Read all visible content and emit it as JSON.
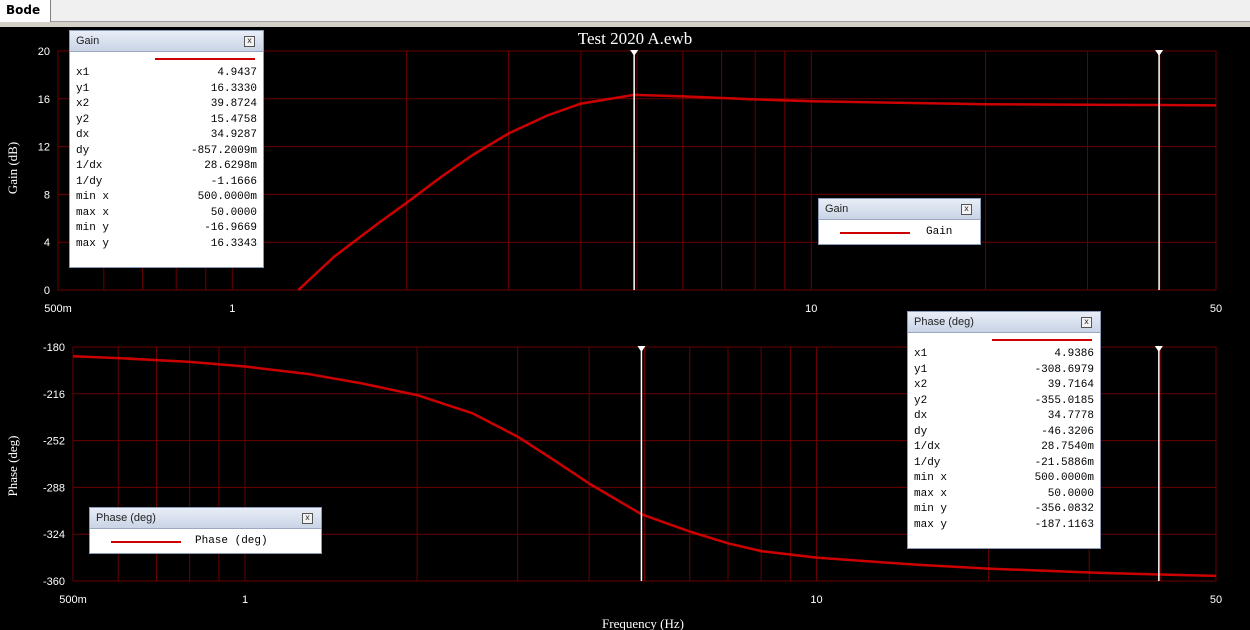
{
  "tab": {
    "label": "Bode"
  },
  "title": "Test 2020 A.ewb",
  "gain_plot": {
    "ylabel": "Gain (dB)",
    "y_ticks": [
      "20",
      "16",
      "12",
      "8",
      "4",
      "0"
    ],
    "x_ticks": [
      "500m",
      "1",
      "10",
      "50"
    ],
    "cursor1_x": 4.9437,
    "cursor2_x": 39.8724,
    "legend": {
      "title": "Gain",
      "label": "Gain"
    },
    "info": {
      "title": "Gain",
      "rows": [
        {
          "k": "x1",
          "v": "4.9437"
        },
        {
          "k": "y1",
          "v": "16.3330"
        },
        {
          "k": "x2",
          "v": "39.8724"
        },
        {
          "k": "y2",
          "v": "15.4758"
        },
        {
          "k": "dx",
          "v": "34.9287"
        },
        {
          "k": "dy",
          "v": "-857.2009m"
        },
        {
          "k": "1/dx",
          "v": "28.6298m"
        },
        {
          "k": "1/dy",
          "v": "-1.1666"
        },
        {
          "k": "min x",
          "v": "500.0000m"
        },
        {
          "k": "max x",
          "v": "50.0000"
        },
        {
          "k": "min y",
          "v": "-16.9669"
        },
        {
          "k": "max y",
          "v": "16.3343"
        }
      ]
    }
  },
  "phase_plot": {
    "ylabel": "Phase (deg)",
    "xlabel": "Frequency (Hz)",
    "y_ticks": [
      "-180",
      "-216",
      "-252",
      "-288",
      "-324",
      "-360"
    ],
    "x_ticks": [
      "500m",
      "1",
      "10",
      "50"
    ],
    "cursor1_x": 4.9386,
    "cursor2_x": 39.7164,
    "legend": {
      "title": "Phase (deg)",
      "label": "Phase (deg)"
    },
    "info": {
      "title": "Phase (deg)",
      "rows": [
        {
          "k": "x1",
          "v": "4.9386"
        },
        {
          "k": "y1",
          "v": "-308.6979"
        },
        {
          "k": "x2",
          "v": "39.7164"
        },
        {
          "k": "y2",
          "v": "-355.0185"
        },
        {
          "k": "dx",
          "v": "34.7778"
        },
        {
          "k": "dy",
          "v": "-46.3206"
        },
        {
          "k": "1/dx",
          "v": "28.7540m"
        },
        {
          "k": "1/dy",
          "v": "-21.5886m"
        },
        {
          "k": "min x",
          "v": "500.0000m"
        },
        {
          "k": "max x",
          "v": "50.0000"
        },
        {
          "k": "min y",
          "v": "-356.0832"
        },
        {
          "k": "max y",
          "v": "-187.1163"
        }
      ]
    }
  },
  "chart_data": [
    {
      "type": "line",
      "ylabel": "Gain (dB)",
      "xlabel": "",
      "x_scale": "log",
      "xlim": [
        0.5,
        50
      ],
      "ylim": [
        0,
        20
      ],
      "grid": true,
      "series": [
        {
          "name": "Gain",
          "color": "#cc0000",
          "x": [
            1.3,
            1.5,
            1.8,
            2.0,
            2.3,
            2.6,
            3.0,
            3.5,
            4.0,
            4.94,
            6.0,
            8.0,
            10.0,
            15.0,
            20.0,
            30.0,
            39.87,
            50.0
          ],
          "y": [
            0.0,
            2.8,
            5.7,
            7.3,
            9.5,
            11.3,
            13.1,
            14.6,
            15.6,
            16.33,
            16.2,
            15.95,
            15.8,
            15.65,
            15.55,
            15.5,
            15.48,
            15.45
          ]
        }
      ]
    },
    {
      "type": "line",
      "ylabel": "Phase (deg)",
      "xlabel": "Frequency (Hz)",
      "x_scale": "log",
      "xlim": [
        0.5,
        50
      ],
      "ylim": [
        -360,
        -180
      ],
      "grid": true,
      "series": [
        {
          "name": "Phase (deg)",
          "color": "#cc0000",
          "x": [
            0.5,
            0.6,
            0.8,
            1.0,
            1.3,
            1.6,
            2.0,
            2.5,
            3.0,
            3.5,
            4.0,
            4.94,
            6.0,
            7.0,
            8.0,
            10.0,
            15.0,
            20.0,
            30.0,
            39.72,
            50.0
          ],
          "y": [
            -187.1,
            -188.5,
            -191.5,
            -195.0,
            -201.0,
            -208.0,
            -217.0,
            -231.0,
            -249.0,
            -268.0,
            -285.0,
            -308.7,
            -322.0,
            -331.0,
            -337.0,
            -342.0,
            -347.5,
            -350.5,
            -353.5,
            -355.0,
            -356.1
          ]
        }
      ]
    }
  ]
}
